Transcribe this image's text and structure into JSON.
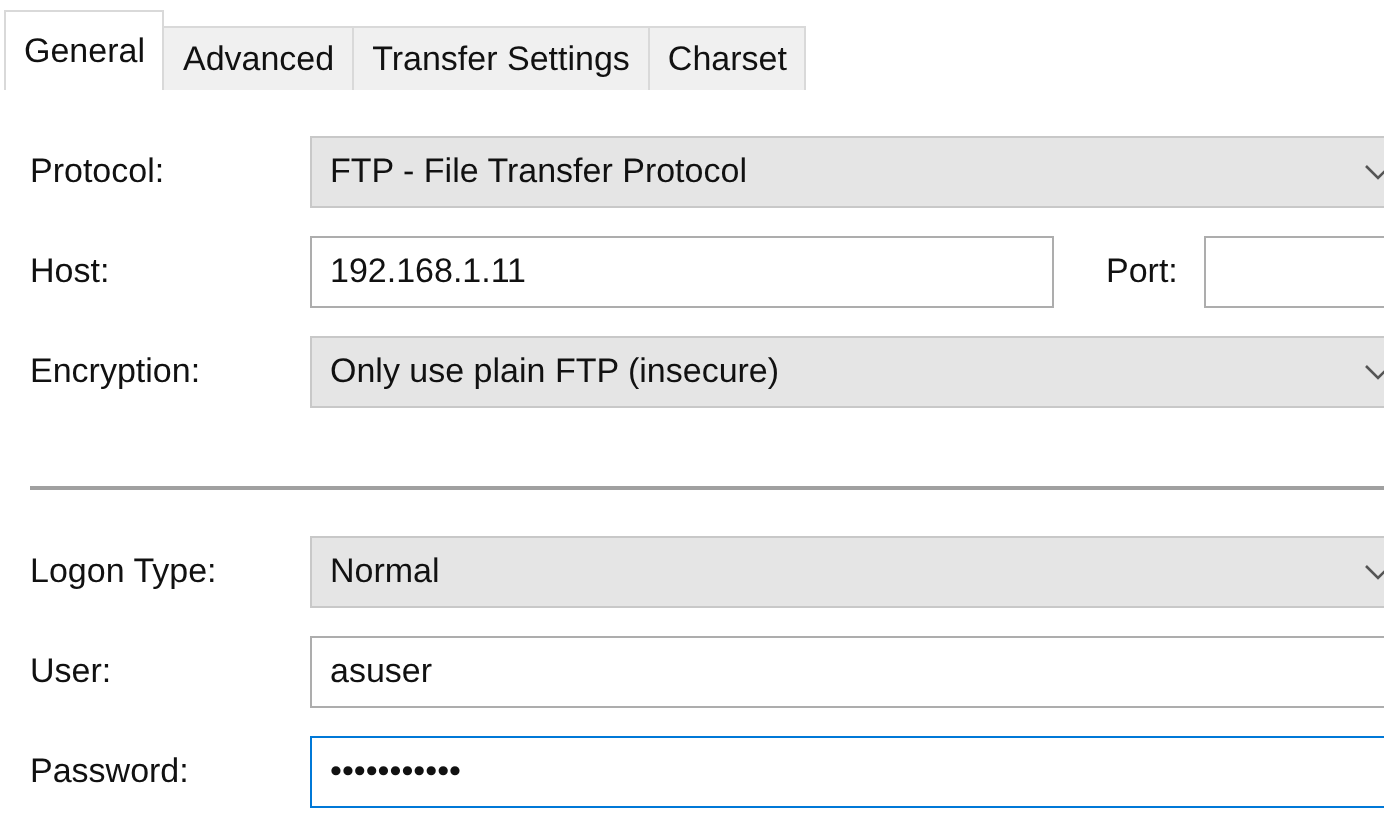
{
  "tabs": [
    {
      "label": "General",
      "selected": true
    },
    {
      "label": "Advanced",
      "selected": false
    },
    {
      "label": "Transfer Settings",
      "selected": false
    },
    {
      "label": "Charset",
      "selected": false
    }
  ],
  "rows": [
    {
      "kind": "dropdown",
      "label": "Protocol:",
      "value": "FTP - File Transfer Protocol"
    },
    {
      "kind": "host",
      "label": "Host:",
      "value": "192.168.1.11",
      "port_label": "Port:"
    },
    {
      "kind": "dropdown",
      "label": "Encryption:",
      "value": "Only use plain FTP (insecure)"
    },
    {
      "kind": "separator"
    },
    {
      "kind": "dropdown",
      "label": "Logon Type:",
      "value": "Normal"
    },
    {
      "kind": "text",
      "label": "User:",
      "value": "asuser",
      "focused": false
    },
    {
      "kind": "text",
      "label": "Password:",
      "value": "•••••••••••",
      "focused": true
    }
  ]
}
